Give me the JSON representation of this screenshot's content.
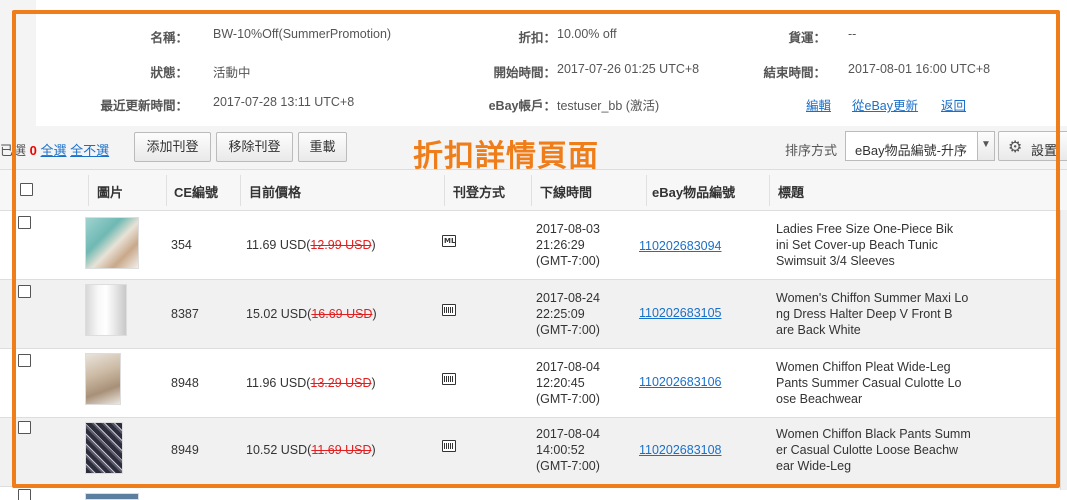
{
  "summary": {
    "name_label": "名稱：",
    "name_value": "BW-10%Off(SummerPromotion)",
    "discount_label": "折扣：",
    "discount_value": "10.00% off",
    "currency_label": "貨運：",
    "currency_value": "--",
    "status_label": "狀態：",
    "status_value": "活動中",
    "start_label": "開始時間：",
    "start_value": "2017-07-26 01:25 UTC+8",
    "end_label": "結束時間：",
    "end_value": "2017-08-01 16:00 UTC+8",
    "updated_label": "最近更新時間：",
    "updated_value": "2017-07-28 13:11 UTC+8",
    "account_label": "eBay帳戶：",
    "account_value": "testuser_bb (激活)",
    "edit_link": "編輯",
    "refresh_link": "從eBay更新",
    "back_link": "返回"
  },
  "toolbar": {
    "selected_prefix": "已選",
    "selected_count": "0",
    "select_all": "全選",
    "select_none": "全不選",
    "add_listing": "添加刊登",
    "remove_listing": "移除刊登",
    "reload": "重載",
    "overlay_title": "折扣詳情頁面",
    "sort_label": "排序方式",
    "sort_value": "eBay物品編號-升序",
    "settings": "設置"
  },
  "table": {
    "headers": {
      "image": "圖片",
      "ce_id": "CE編號",
      "price": "目前價格",
      "listing_type": "刊登方式",
      "end_time": "下線時間",
      "ebay_id": "eBay物品編號",
      "title": "標題"
    },
    "rows": [
      {
        "ce_id": "354",
        "price_now": "11.69 USD(",
        "price_old": "12.99 USD",
        "price_close": ")",
        "listing_icon": "ml-icon",
        "end_date": "2017-08-03",
        "end_clock": "21:26:29",
        "end_tz": "(GMT-7:00)",
        "ebay_id": "110202683094",
        "title_1": "Ladies Free Size One-Piece Bik",
        "title_2": "ini Set Cover-up Beach Tunic",
        "title_3": "Swimsuit 3/4 Sleeves"
      },
      {
        "ce_id": "8387",
        "price_now": "15.02 USD(",
        "price_old": "16.69 USD",
        "price_close": ")",
        "listing_icon": "fixed-price-icon",
        "end_date": "2017-08-24",
        "end_clock": "22:25:09",
        "end_tz": "(GMT-7:00)",
        "ebay_id": "110202683105",
        "title_1": "Women's Chiffon Summer Maxi Lo",
        "title_2": "ng Dress Halter Deep V Front B",
        "title_3": "are Back White"
      },
      {
        "ce_id": "8948",
        "price_now": "11.96 USD(",
        "price_old": "13.29 USD",
        "price_close": ")",
        "listing_icon": "fixed-price-icon",
        "end_date": "2017-08-04",
        "end_clock": "12:20:45",
        "end_tz": "(GMT-7:00)",
        "ebay_id": "110202683106",
        "title_1": "Women Chiffon Pleat Wide-Leg",
        "title_2": "Pants Summer Casual Culotte Lo",
        "title_3": "ose Beachwear"
      },
      {
        "ce_id": "8949",
        "price_now": "10.52 USD(",
        "price_old": "11.69 USD",
        "price_close": ")",
        "listing_icon": "fixed-price-icon",
        "end_date": "2017-08-04",
        "end_clock": "14:00:52",
        "end_tz": "(GMT-7:00)",
        "ebay_id": "110202683108",
        "title_1": "Women Chiffon Black Pants Summ",
        "title_2": "er Casual Culotte Loose Beachw",
        "title_3": "ear Wide-Leg"
      }
    ]
  },
  "colors": {
    "highlight_frame": "#ef7d1a",
    "link": "#1a6fc9",
    "strike_price": "#e02020"
  }
}
